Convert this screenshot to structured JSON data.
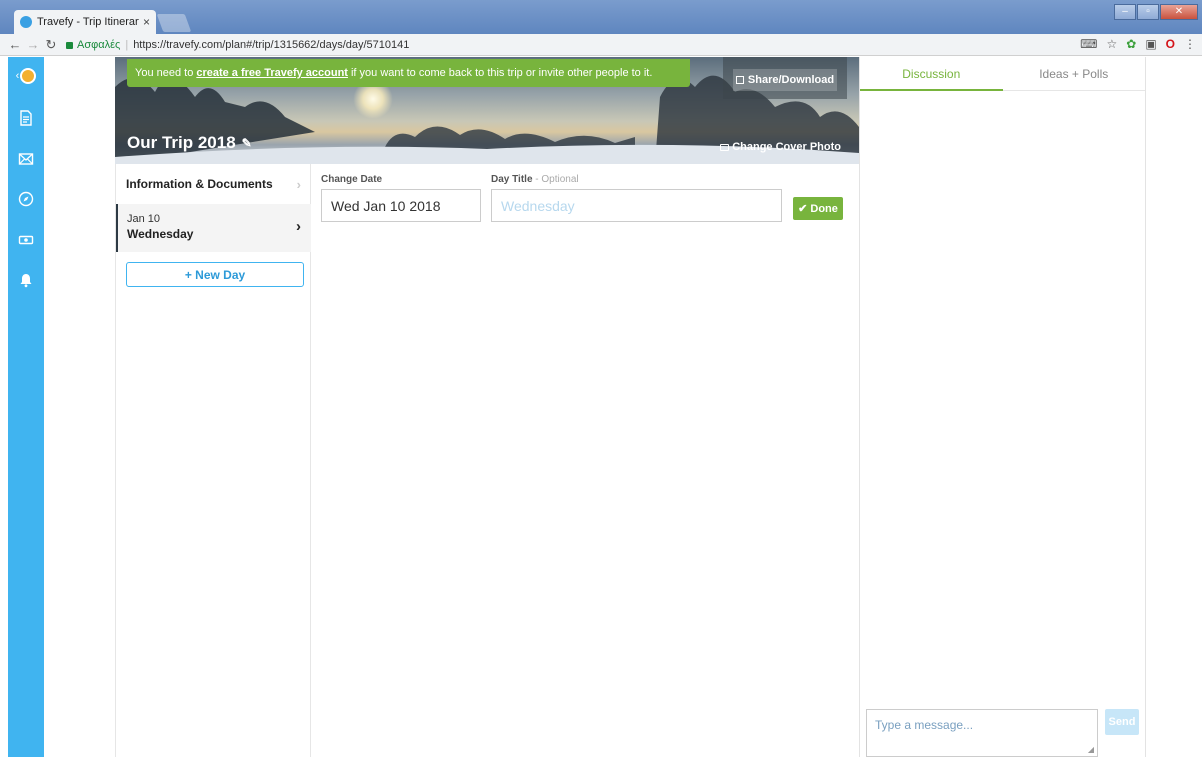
{
  "browser": {
    "tab_title": "Travefy - Trip Itinerary",
    "tab_close": "×",
    "secure_label": "Ασφαλές",
    "url": "https://travefy.com/plan#/trip/1315662/days/day/5710141"
  },
  "banner": {
    "prefix": "You need to",
    "link": "create a free Travefy account",
    "suffix": "if you want to come back to this trip or invite other people to it."
  },
  "hero": {
    "share_label": "Share/Download",
    "trip_title": "Our Trip 2018",
    "change_cover_label": "Change Cover Photo"
  },
  "daylist": {
    "info_docs_label": "Information & Documents",
    "days": [
      {
        "date": "Jan 10",
        "name": "Wednesday"
      }
    ],
    "new_day_label": "+ New Day"
  },
  "form": {
    "date_label": "Change Date",
    "date_value": "Wed Jan 10 2018",
    "title_label": "Day Title",
    "title_optional": "- Optional",
    "title_placeholder": "Wednesday",
    "done_label": "✔ Done"
  },
  "panel": {
    "tabs": [
      "Discussion",
      "Ideas + Polls"
    ],
    "message_placeholder": "Type a message...",
    "send_label": "Send"
  },
  "colors": {
    "nav_blue": "#40b4f0",
    "accent_green": "#78b43d"
  },
  "icons": [
    "avatar",
    "document-icon",
    "mail-icon",
    "compass-icon",
    "money-icon",
    "bell-icon",
    "pencil-icon",
    "camera-icon",
    "share-icon",
    "chevron-right-icon"
  ]
}
